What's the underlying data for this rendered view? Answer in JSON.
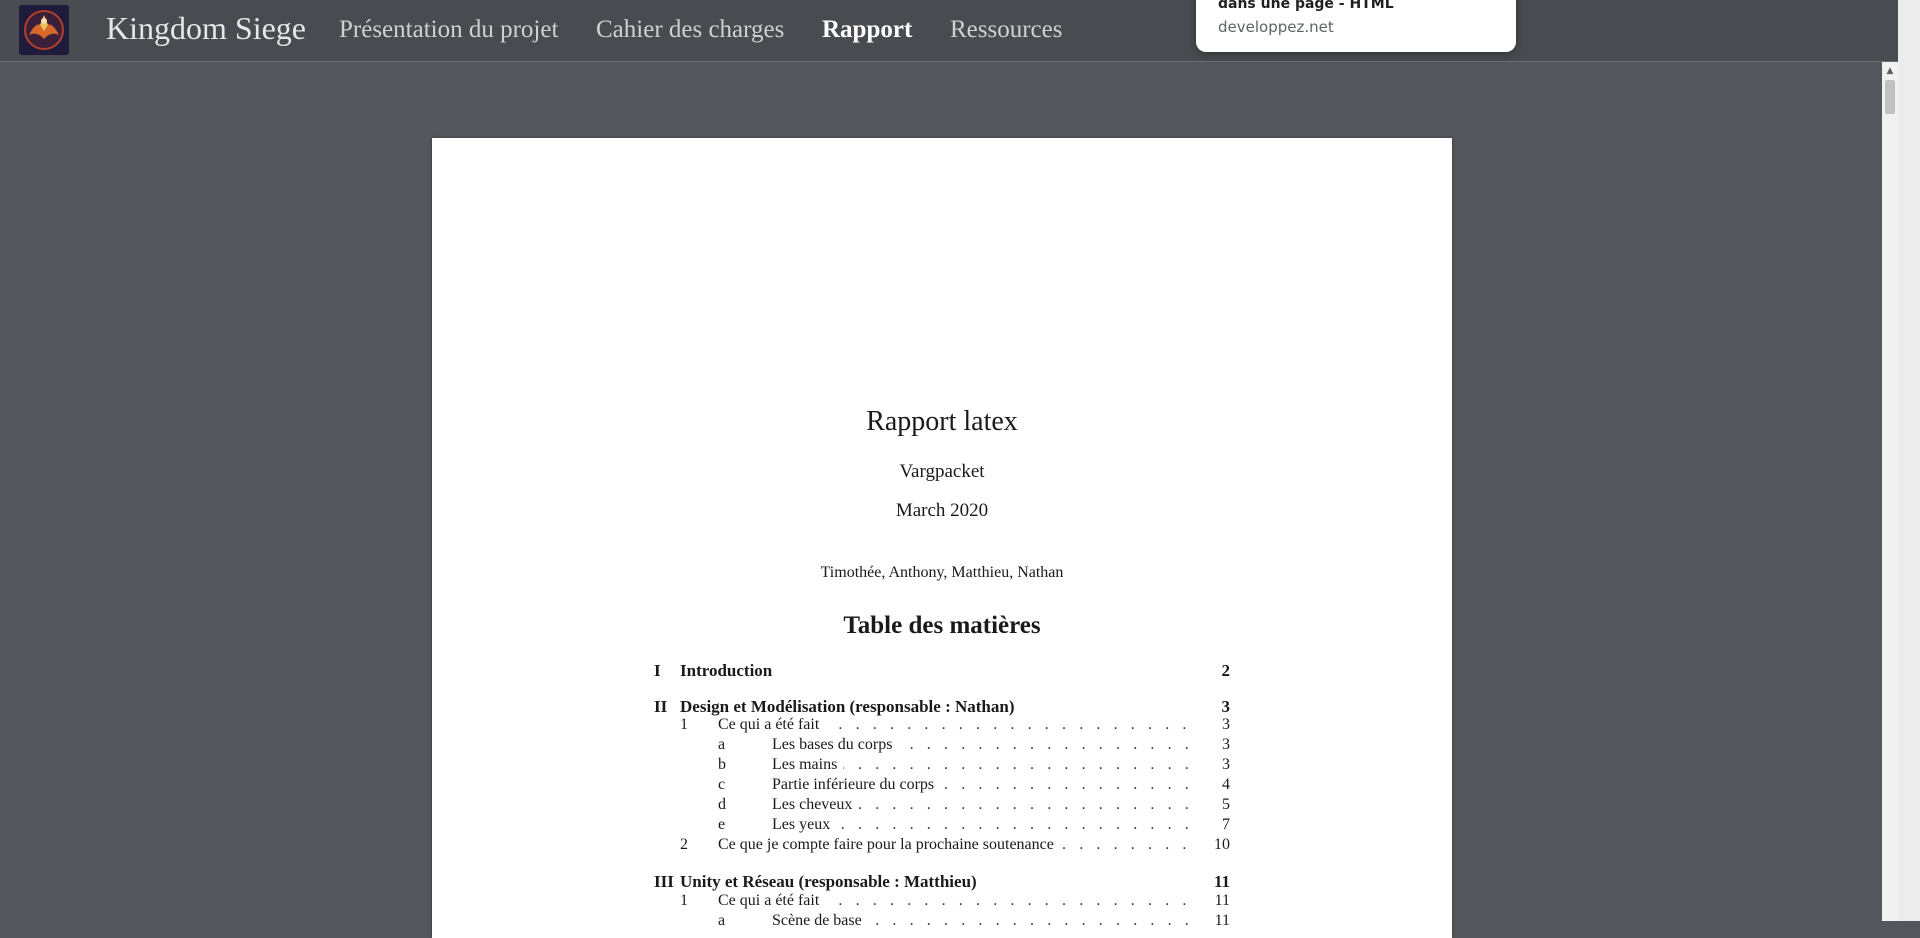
{
  "nav": {
    "brand": "Kingdom Siege",
    "items": [
      {
        "label": "Présentation du projet"
      },
      {
        "label": "Cahier des charges"
      },
      {
        "label": "Rapport"
      },
      {
        "label": "Ressources"
      }
    ]
  },
  "popover": {
    "title": "dans une page - HTML",
    "domain": "developpez.net"
  },
  "document": {
    "title": "Rapport latex",
    "author": "Vargpacket",
    "date": "March 2020",
    "authors": "Timothée, Anthony, Matthieu, Nathan",
    "toc_title": "Table des matières",
    "toc": [
      {
        "level": "part",
        "num": "I",
        "title": "Introduction",
        "page": "2"
      },
      {
        "level": "part",
        "num": "II",
        "title": "Design et Modélisation (responsable : Nathan)",
        "page": "3"
      },
      {
        "level": "section",
        "num": "1",
        "title": "Ce qui a été fait",
        "page": "3"
      },
      {
        "level": "sub",
        "num": "a",
        "title": "Les bases du corps",
        "page": "3"
      },
      {
        "level": "sub",
        "num": "b",
        "title": "Les mains",
        "page": "3"
      },
      {
        "level": "sub",
        "num": "c",
        "title": "Partie inférieure du corps",
        "page": "4"
      },
      {
        "level": "sub",
        "num": "d",
        "title": "Les cheveux",
        "page": "5"
      },
      {
        "level": "sub",
        "num": "e",
        "title": "Les yeux",
        "page": "7"
      },
      {
        "level": "section",
        "num": "2",
        "title": "Ce que je compte faire pour la prochaine soutenance",
        "page": "10"
      },
      {
        "level": "part",
        "num": "III",
        "title": "Unity et Réseau (responsable : Matthieu)",
        "page": "11"
      },
      {
        "level": "section",
        "num": "1",
        "title": "Ce qui a été fait",
        "page": "11"
      },
      {
        "level": "sub",
        "num": "a",
        "title": "Scène de base",
        "page": "11"
      }
    ]
  }
}
